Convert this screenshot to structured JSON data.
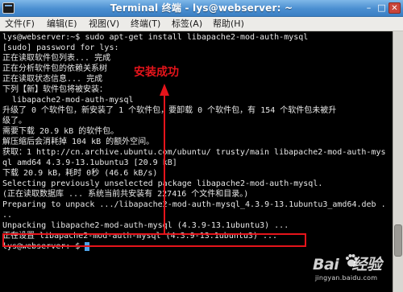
{
  "window": {
    "title": "Terminal 终端 - lys@webserver: ~",
    "buttons": {
      "minimize": "–",
      "maximize": "□",
      "close": "✕"
    }
  },
  "menu": {
    "items": [
      "文件(F)",
      "编辑(E)",
      "视图(V)",
      "终端(T)",
      "标签(A)",
      "帮助(H)"
    ]
  },
  "terminal": {
    "lines": [
      "lys@webserver:~$ sudo apt-get install libapache2-mod-auth-mysql",
      "[sudo] password for lys:",
      "正在读取软件包列表... 完成",
      "正在分析软件包的依赖关系树",
      "正在读取状态信息... 完成",
      "下列【新】软件包将被安装：",
      "  libapache2-mod-auth-mysql",
      "升级了 0 个软件包，新安装了 1 个软件包，要卸载 0 个软件包，有 154 个软件包未被升",
      "级了。",
      "需要下载 20.9 kB 的软件包。",
      "解压缩后会消耗掉 104 kB 的额外空间。",
      "获取：1 http://cn.archive.ubuntu.com/ubuntu/ trusty/main libapache2-mod-auth-mys",
      "ql amd64 4.3.9-13.1ubuntu3 [20.9 kB]",
      "下载 20.9 kB，耗时 0秒 (46.6 kB/s)",
      "Selecting previously unselected package libapache2-mod-auth-mysql.",
      "(正在读取数据库 ... 系统当前共安装有 227416 个文件和目录。)",
      "Preparing to unpack .../libapache2-mod-auth-mysql_4.3.9-13.1ubuntu3_amd64.deb .",
      "..",
      "Unpacking libapache2-mod-auth-mysql (4.3.9-13.1ubuntu3) ...",
      "正在设置 libapache2-mod-auth-mysql (4.3.9-13.1ubuntu3) ...",
      "lys@webserver:~$ "
    ],
    "scrollbar_position": 0.85
  },
  "annotation": {
    "label": "安装成功",
    "color": "#e5141b"
  },
  "watermark": {
    "logo": "Bai",
    "logo_suffix": "经验",
    "sub": "jingyan.baidu.com"
  }
}
